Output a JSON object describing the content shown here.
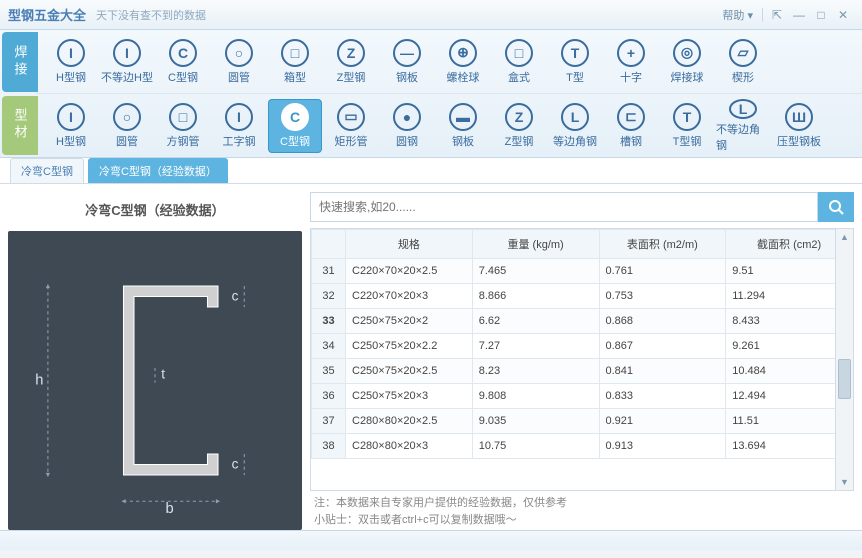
{
  "titlebar": {
    "app_title": "型钢五金大全",
    "subtitle": "天下没有查不到的数据",
    "help": "帮助 ▾"
  },
  "side_tabs": {
    "welding": "焊接",
    "material": "型材"
  },
  "ribbon_row1": [
    {
      "icon": "I",
      "label": "H型钢"
    },
    {
      "icon": "I",
      "label": "不等边H型"
    },
    {
      "icon": "C",
      "label": "C型钢"
    },
    {
      "icon": "○",
      "label": "圆管"
    },
    {
      "icon": "□",
      "label": "箱型"
    },
    {
      "icon": "Z",
      "label": "Z型钢"
    },
    {
      "icon": "—",
      "label": "钢板"
    },
    {
      "icon": "⊕",
      "label": "螺栓球"
    },
    {
      "icon": "□",
      "label": "盒式"
    },
    {
      "icon": "T",
      "label": "T型"
    },
    {
      "icon": "+",
      "label": "十字"
    },
    {
      "icon": "◎",
      "label": "焊接球"
    },
    {
      "icon": "▱",
      "label": "楔形"
    }
  ],
  "ribbon_row2": [
    {
      "icon": "I",
      "label": "H型钢"
    },
    {
      "icon": "○",
      "label": "圆管"
    },
    {
      "icon": "□",
      "label": "方钢管"
    },
    {
      "icon": "I",
      "label": "工字钢"
    },
    {
      "icon": "C",
      "label": "C型钢",
      "active": true
    },
    {
      "icon": "▭",
      "label": "矩形管"
    },
    {
      "icon": "●",
      "label": "圆钢"
    },
    {
      "icon": "▬",
      "label": "钢板"
    },
    {
      "icon": "Z",
      "label": "Z型钢"
    },
    {
      "icon": "L",
      "label": "等边角钢"
    },
    {
      "icon": "⊏",
      "label": "槽钢"
    },
    {
      "icon": "T",
      "label": "T型钢"
    },
    {
      "icon": "L",
      "label": "不等边角钢"
    },
    {
      "icon": "Ш",
      "label": "压型钢板"
    }
  ],
  "tabs": [
    {
      "label": "冷弯C型钢",
      "active": false
    },
    {
      "label": "冷弯C型钢（经验数据）",
      "active": true
    }
  ],
  "left_title": "冷弯C型钢（经验数据）",
  "diagram_labels": {
    "h": "h",
    "b": "b",
    "c_top": "c",
    "c_bottom": "c",
    "t": "t"
  },
  "search": {
    "placeholder": "快速搜索,如20......"
  },
  "table": {
    "headers": [
      "",
      "规格",
      "重量 (kg/m)",
      "表面积 (m2/m)",
      "截面积 (cm2)"
    ],
    "rows": [
      {
        "n": "31",
        "spec": "C220×70×20×2.5",
        "w": "7.465",
        "s": "0.761",
        "a": "9.51"
      },
      {
        "n": "32",
        "spec": "C220×70×20×3",
        "w": "8.866",
        "s": "0.753",
        "a": "11.294"
      },
      {
        "n": "33",
        "spec": "C250×75×20×2",
        "w": "6.62",
        "s": "0.868",
        "a": "8.433",
        "selected": true
      },
      {
        "n": "34",
        "spec": "C250×75×20×2.2",
        "w": "7.27",
        "s": "0.867",
        "a": "9.261"
      },
      {
        "n": "35",
        "spec": "C250×75×20×2.5",
        "w": "8.23",
        "s": "0.841",
        "a": "10.484"
      },
      {
        "n": "36",
        "spec": "C250×75×20×3",
        "w": "9.808",
        "s": "0.833",
        "a": "12.494"
      },
      {
        "n": "37",
        "spec": "C280×80×20×2.5",
        "w": "9.035",
        "s": "0.921",
        "a": "11.51"
      },
      {
        "n": "38",
        "spec": "C280×80×20×3",
        "w": "10.75",
        "s": "0.913",
        "a": "13.694"
      }
    ]
  },
  "footnote1": "注：本数据来自专家用户提供的经验数据，仅供参考",
  "footnote2": "小贴士：双击或者ctrl+c可以复制数据哦～"
}
